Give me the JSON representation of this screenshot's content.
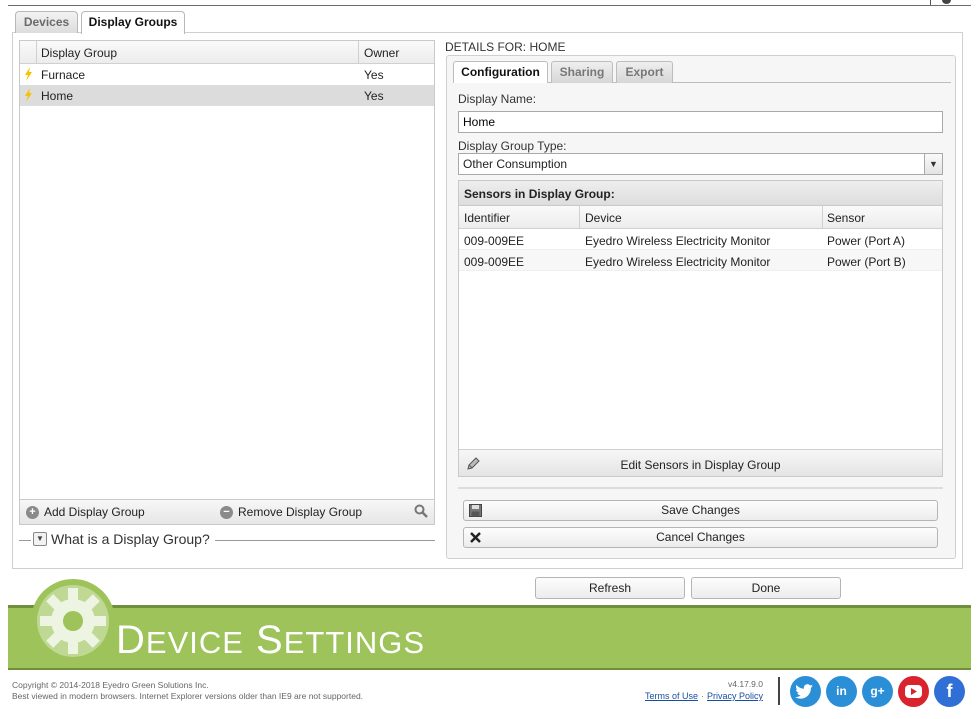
{
  "tabs": {
    "devices": "Devices",
    "display_groups": "Display Groups"
  },
  "groups": {
    "header": {
      "name": "Display Group",
      "owner": "Owner"
    },
    "rows": [
      {
        "name": "Furnace",
        "owner": "Yes"
      },
      {
        "name": "Home",
        "owner": "Yes"
      }
    ],
    "add_label": "Add Display Group",
    "remove_label": "Remove Display Group",
    "help_label": "What is a Display Group?"
  },
  "details": {
    "title": "DETAILS FOR: HOME",
    "subtabs": {
      "configuration": "Configuration",
      "sharing": "Sharing",
      "export": "Export"
    },
    "display_name_label": "Display Name:",
    "display_name_value": "Home",
    "type_label": "Display Group Type:",
    "type_value": "Other Consumption",
    "sensors": {
      "title": "Sensors in Display Group:",
      "columns": {
        "identifier": "Identifier",
        "device": "Device",
        "sensor": "Sensor"
      },
      "rows": [
        {
          "identifier": "009-009EE",
          "device": "Eyedro Wireless Electricity Monitor",
          "sensor": "Power (Port A)"
        },
        {
          "identifier": "009-009EE",
          "device": "Eyedro Wireless Electricity Monitor",
          "sensor": "Power (Port B)"
        }
      ],
      "edit_label": "Edit Sensors in Display Group"
    },
    "save_label": "Save Changes",
    "cancel_label": "Cancel Changes"
  },
  "buttons": {
    "refresh": "Refresh",
    "done": "Done"
  },
  "banner": {
    "first_initial": "D",
    "first_rest": "EVICE",
    "second_initial": "S",
    "second_rest": "ETTINGS"
  },
  "footer": {
    "copyright": "Copyright © 2014-2018 Eyedro Green Solutions Inc.",
    "browser_note": "Best viewed in modern browsers. Internet Explorer versions older than IE9 are not supported.",
    "version": "v4.17.9.0",
    "terms": "Terms of Use",
    "privacy": "Privacy Policy"
  },
  "social": [
    {
      "name": "twitter-icon",
      "glyph": "",
      "color": "#2a8fd6"
    },
    {
      "name": "linkedin-icon",
      "glyph": "in",
      "color": "#2a8fd6"
    },
    {
      "name": "googleplus-icon",
      "glyph": "g+",
      "color": "#2a8fd6"
    },
    {
      "name": "youtube-icon",
      "glyph": "",
      "color": "#d9232d"
    },
    {
      "name": "facebook-icon",
      "glyph": "f",
      "color": "#2f6fd6"
    }
  ],
  "colors": {
    "banner_green": "#9dc35a",
    "bolt_yellow": "#f5c400",
    "link_blue": "#1a4fa0"
  }
}
